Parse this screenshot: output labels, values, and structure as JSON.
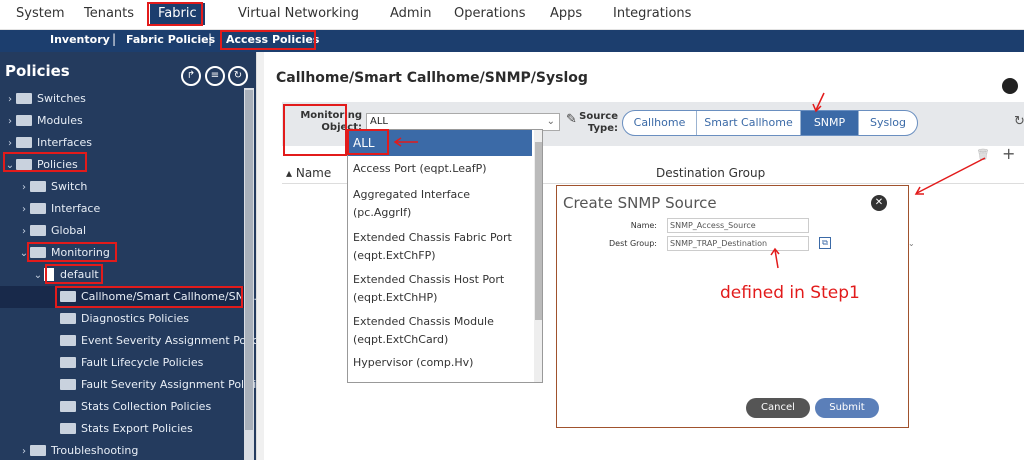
{
  "topnav": {
    "items": [
      "System",
      "Tenants",
      "Fabric",
      "Virtual Networking",
      "Admin",
      "Operations",
      "Apps",
      "Integrations"
    ],
    "active": "Fabric"
  },
  "subnav": {
    "items": [
      "Inventory",
      "Fabric Policies",
      "Access Policies"
    ],
    "separator": "|"
  },
  "sidebar": {
    "title": "Policies",
    "tree": [
      "Switches",
      "Modules",
      "Interfaces",
      "Policies",
      "Switch",
      "Interface",
      "Global",
      "Monitoring",
      "default",
      "Callhome/Smart Callhome/SNM...",
      "Diagnostics Policies",
      "Event Severity Assignment Polic...",
      "Fault Lifecycle Policies",
      "Fault Severity Assignment Polici...",
      "Stats Collection Policies",
      "Stats Export Policies",
      "Troubleshooting"
    ]
  },
  "main": {
    "title": "Callhome/Smart Callhome/SNMP/Syslog",
    "monitoring_label_1": "Monitoring",
    "monitoring_label_2": "Object:",
    "monitoring_value": "ALL",
    "source_label_1": "Source",
    "source_label_2": "Type:",
    "source_types": [
      "Callhome",
      "Smart Callhome",
      "SNMP",
      "Syslog"
    ],
    "source_selected": "SNMP",
    "col_name": "Name",
    "col_dest": "Destination Group"
  },
  "dropdown": {
    "items": [
      "ALL",
      "Access Port (eqpt.LeafP)",
      "Aggregated Interface",
      "(pc.AggrIf)",
      "Extended Chassis Fabric Port",
      "(eqpt.ExtChFP)",
      "Extended Chassis Host Port",
      "(eqpt.ExtChHP)",
      "Extended Chassis Module",
      "(eqpt.ExtChCard)",
      "Hypervisor (comp.Hv)"
    ]
  },
  "modal": {
    "title": "Create SNMP Source",
    "name_label": "Name:",
    "name_value": "SNMP_Access_Source",
    "dest_label": "Dest Group:",
    "dest_value": "SNMP_TRAP_Destination",
    "cancel_label": "Cancel",
    "submit_label": "Submit"
  },
  "annotation": {
    "text": "defined in Step1",
    "color": "#e21b1b"
  },
  "colors": {
    "nav_dark": "#1c3e6e",
    "sidebar": "#243b5e",
    "accent": "#3b6aa7"
  }
}
